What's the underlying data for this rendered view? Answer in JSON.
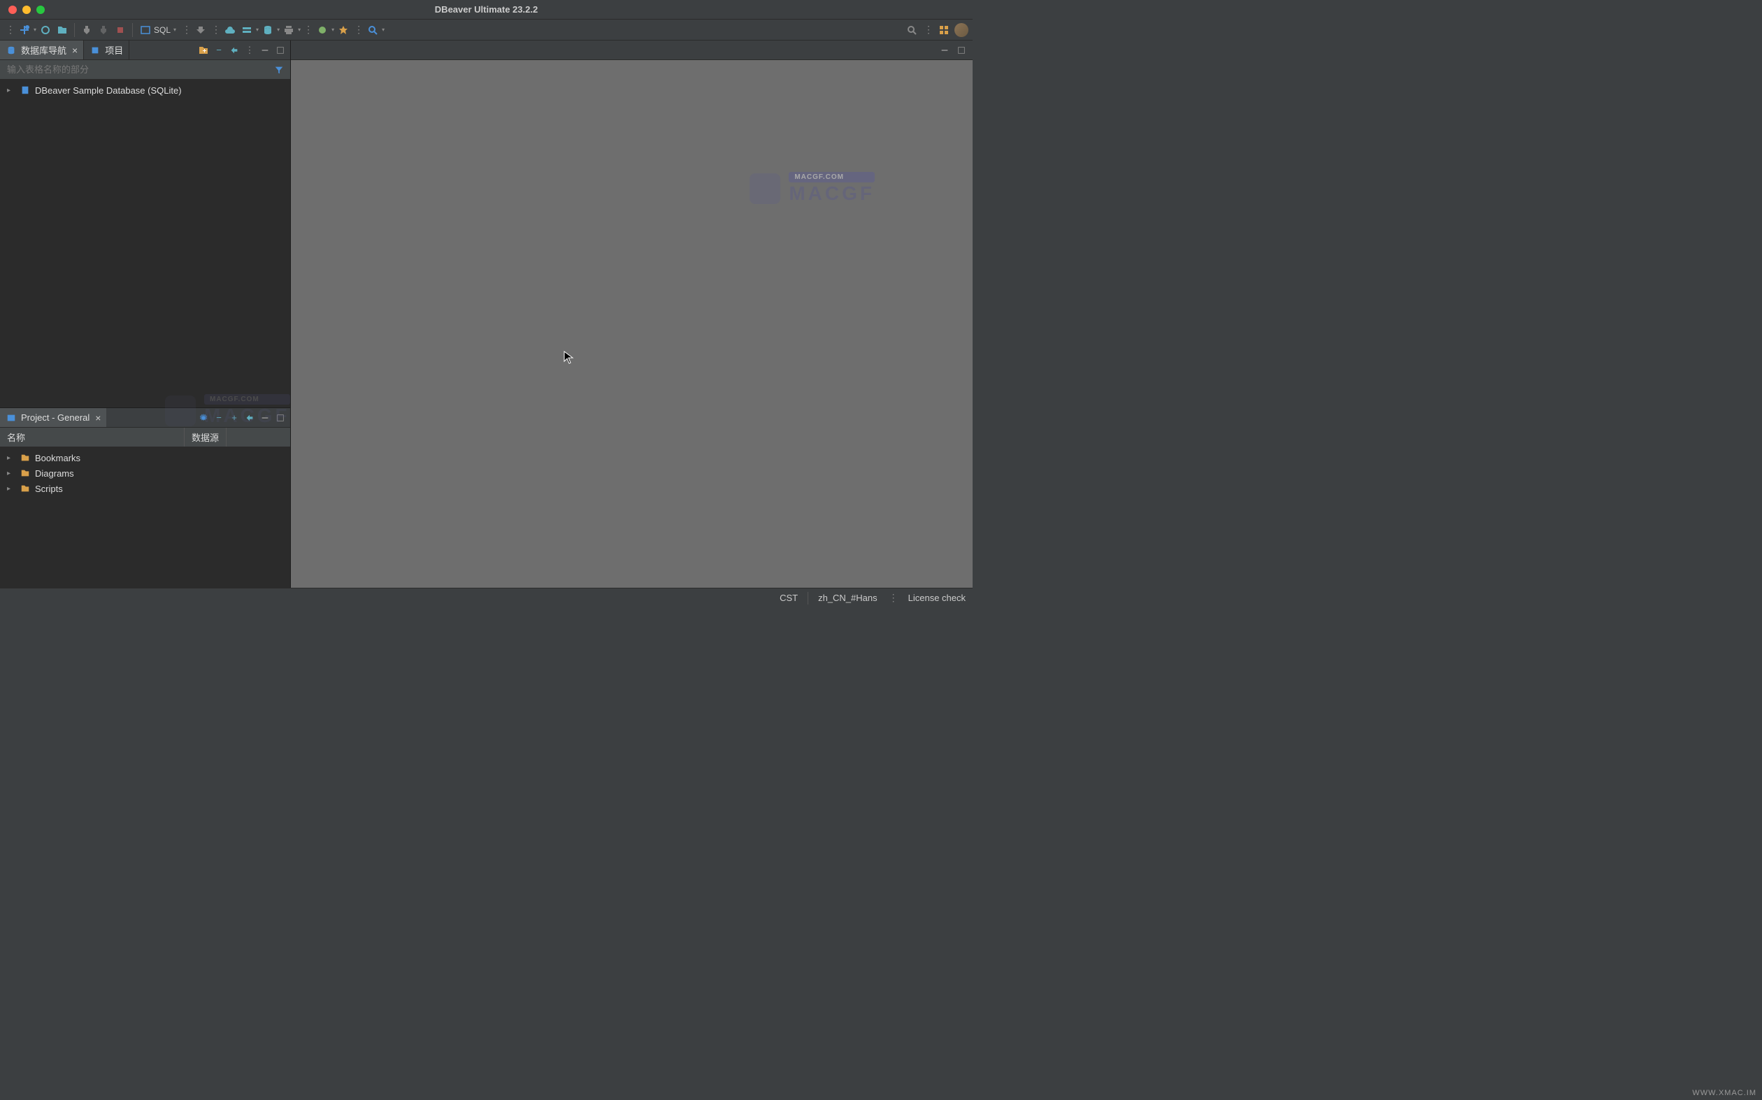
{
  "app": {
    "title": "DBeaver Ultimate 23.2.2"
  },
  "toolbar": {
    "sql_label": "SQL"
  },
  "navigator": {
    "tab_label": "数据库导航",
    "projects_tab_label": "项目",
    "filter_placeholder": "输入表格名称的部分",
    "items": [
      {
        "label": "DBeaver Sample Database (SQLite)"
      }
    ]
  },
  "project": {
    "tab_label": "Project - General",
    "columns": {
      "name": "名称",
      "datasource": "数据源"
    },
    "items": [
      {
        "label": "Bookmarks"
      },
      {
        "label": "Diagrams"
      },
      {
        "label": "Scripts"
      }
    ]
  },
  "watermark": {
    "text": "MACGF",
    "url": "MACGF.COM"
  },
  "statusbar": {
    "timezone": "CST",
    "locale": "zh_CN_#Hans",
    "license": "License check"
  },
  "footer_watermark": "WWW.XMAC.IM"
}
